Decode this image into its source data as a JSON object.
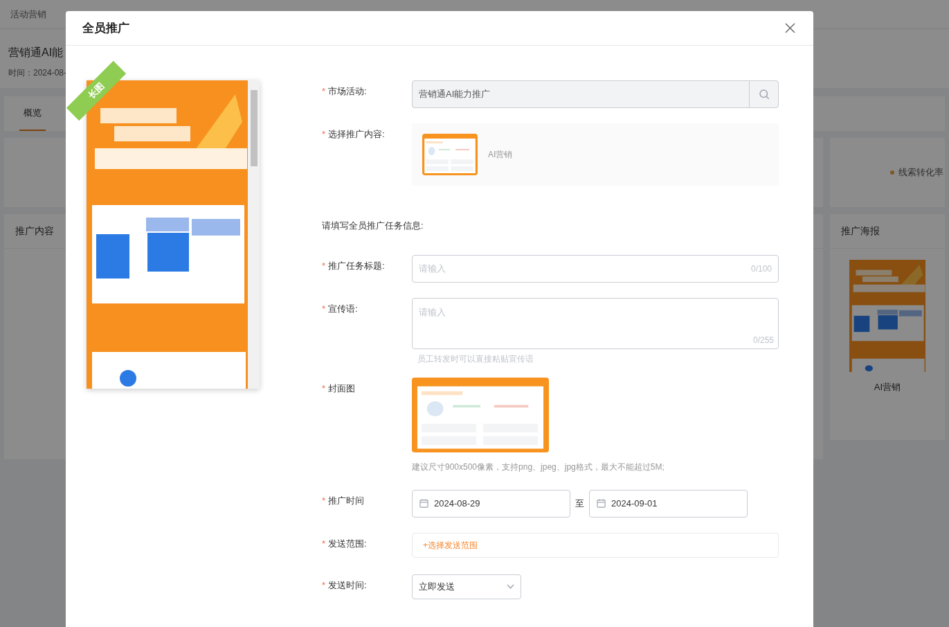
{
  "background": {
    "breadcrumb": [
      "活动营销"
    ],
    "title": "营销通AI能",
    "time": "时间：2024-08-",
    "tabs": [
      {
        "label": "概览",
        "selected": true
      }
    ],
    "content_panel": {
      "title": "推广内容"
    },
    "metric": "线索转化率",
    "poster_panel": {
      "title": "推广海报",
      "caption": "AI营销"
    }
  },
  "dialog": {
    "title": "全员推广",
    "poster_badge": "长图",
    "fields": [
      {
        "kind": "search",
        "label": "市场活动:",
        "mark": "*",
        "value": "营销通AI能力推广"
      },
      {
        "kind": "content",
        "label": "选择推广内容:",
        "mark": "*",
        "item": "AI营销"
      },
      {
        "kind": "section",
        "label": "请填写全员推广任务信息:"
      },
      {
        "kind": "input",
        "label": "推广任务标题:",
        "mark": "*",
        "placeholder": "请输入",
        "counter": "0/100"
      },
      {
        "kind": "textarea",
        "label": "宣传语:",
        "mark": "*",
        "placeholder": "请输入",
        "counter": "0/255",
        "hint": "员工转发时可以直接粘贴宣传语"
      },
      {
        "label": "封面图",
        "mark": "*",
        "hint": "建议尺寸900x500像素，支持png、jpeg、jpg格式，最大不能超过5M;"
      },
      {
        "kind": "daterange",
        "label": "推广时间",
        "mark": "*",
        "start": "2024-08-29",
        "separator": "至",
        "end": "2024-09-01"
      },
      {
        "kind": "link",
        "label": "发送范围:",
        "mark": "*",
        "link": "+选择发送范围"
      },
      {
        "kind": "select",
        "label": "发送时间:",
        "mark": "*",
        "value": "立即发送"
      }
    ]
  }
}
